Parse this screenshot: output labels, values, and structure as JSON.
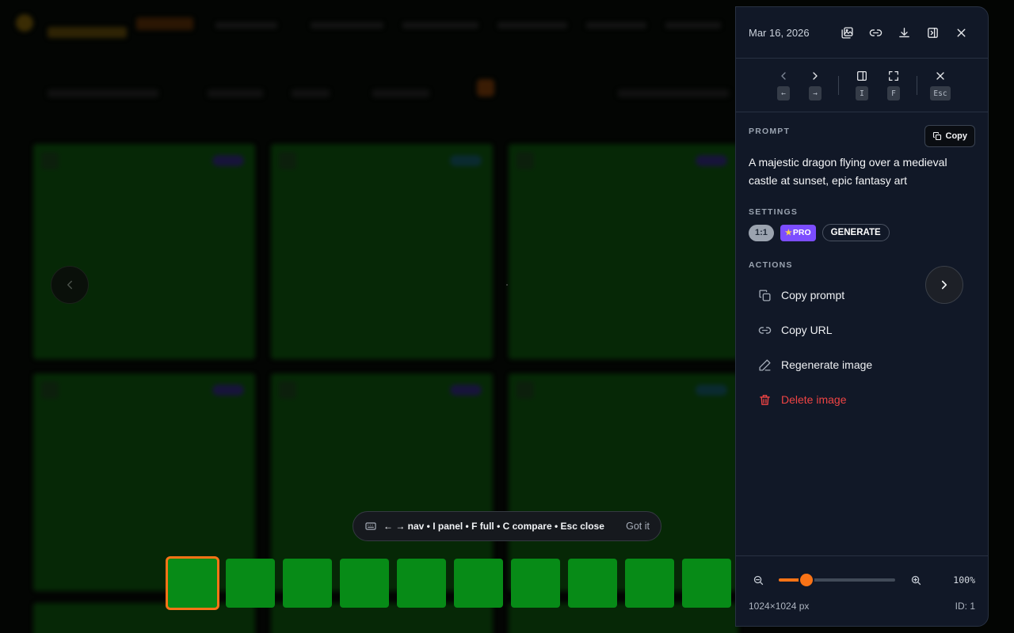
{
  "panel": {
    "date": "Mar 16, 2026",
    "header_icons": [
      "compare-icon",
      "link-icon",
      "download-icon",
      "toggle-panel-icon",
      "close-icon"
    ],
    "nav": {
      "prev_key": "←",
      "next_key": "→",
      "panel_key": "I",
      "fullscreen_key": "F",
      "close_key": "Esc"
    },
    "prompt": {
      "label": "PROMPT",
      "copy_label": "Copy",
      "text": "A majestic dragon flying over a medieval castle at sunset, epic fantasy art"
    },
    "settings": {
      "label": "SETTINGS",
      "ratio": "1:1",
      "tier": "PRO",
      "mode": "GENERATE",
      "tier_color": "#7c4dff"
    },
    "actions": {
      "label": "ACTIONS",
      "items": [
        {
          "label": "Copy prompt",
          "icon": "copy-icon"
        },
        {
          "label": "Copy URL",
          "icon": "link-icon"
        },
        {
          "label": "Regenerate image",
          "icon": "pencil-icon"
        },
        {
          "label": "Delete image",
          "icon": "trash-icon"
        }
      ]
    },
    "footer": {
      "zoom_value": "100%",
      "zoom_fraction": 0.24,
      "dimensions": "1024×1024 px",
      "id": "ID: 1"
    }
  },
  "hint": {
    "text": "← → nav • I panel • F full • C compare • Esc close",
    "dismiss": "Got it"
  },
  "thumbnails": {
    "count": 10,
    "active_index": 0,
    "color": "#078b17",
    "active_border": "#f97316"
  },
  "colors": {
    "accent": "#f97316",
    "danger": "#ef4444",
    "panel_bg": "#111827"
  }
}
